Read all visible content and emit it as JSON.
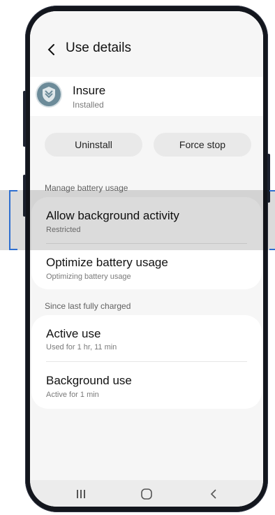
{
  "header": {
    "title": "Use details"
  },
  "app": {
    "name": "Insure",
    "status": "Installed"
  },
  "actions": {
    "uninstall_label": "Uninstall",
    "force_stop_label": "Force stop"
  },
  "manage_battery": {
    "section_label": "Manage battery usage",
    "items": [
      {
        "title": "Allow background activity",
        "subtitle": "Restricted"
      },
      {
        "title": "Optimize battery usage",
        "subtitle": "Optimizing battery usage"
      }
    ]
  },
  "since_charged": {
    "section_label": "Since last fully charged",
    "items": [
      {
        "title": "Active use",
        "subtitle": "Used for 1 hr, 11 min"
      },
      {
        "title": "Background use",
        "subtitle": "Active for 1 min"
      }
    ]
  },
  "navbar": {
    "icons": [
      "recent-apps-icon",
      "home-icon",
      "back-icon"
    ]
  },
  "colors": {
    "highlight_border": "#2f6fd0",
    "background": "#f6f6f6",
    "card": "#ffffff"
  }
}
